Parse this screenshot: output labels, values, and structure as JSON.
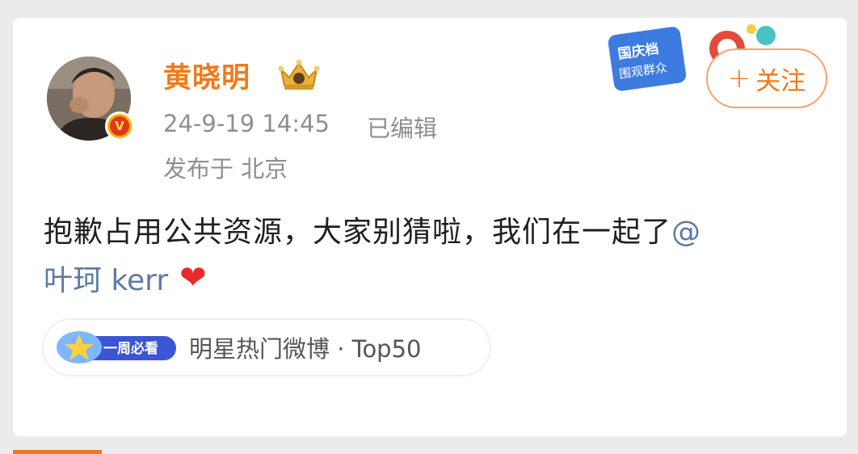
{
  "post": {
    "author": {
      "name": "黄晓明",
      "verified_badge": "V"
    },
    "time": "24-9-19 14:45",
    "edited": "已编辑",
    "location": "发布于 北京",
    "follow_label": "关注",
    "follow_plus": "+",
    "content_line1": "抱歉占用公共资源，大家别猜啦，我们在一起了",
    "mention_at": "@",
    "mention_name": "叶珂 kerr",
    "heart": "❤",
    "hot_badge_label": "一周必看",
    "hot_text": "明星热门微博 · Top50",
    "ad_banner_line1": "国庆档",
    "ad_banner_line2": "围观群众"
  },
  "colors": {
    "accent_orange": "#f07a1a",
    "mention_blue": "#5c7aa6",
    "meta_gray": "#8f8f8f",
    "heart_red": "#e82a2a"
  },
  "icons": {
    "avatar": "avatar-photo",
    "verified": "verified-v-icon",
    "crown": "crown-level-icon",
    "heart": "heart-emoji-icon",
    "hot_badge": "weekly-must-see-badge-icon"
  }
}
